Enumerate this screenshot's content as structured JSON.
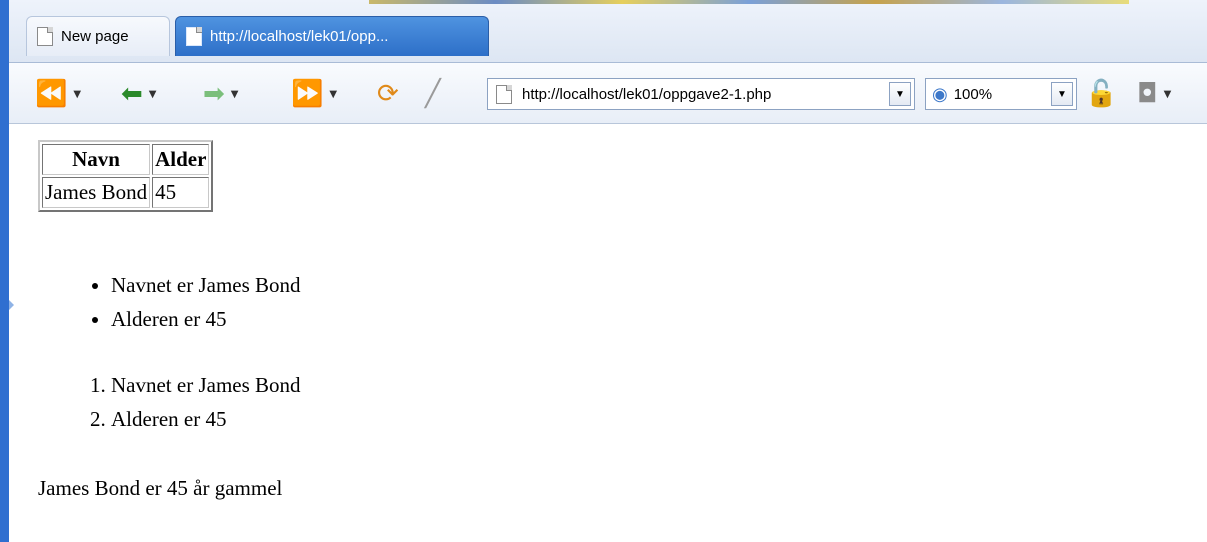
{
  "tabs": [
    {
      "label": "New page",
      "active": false
    },
    {
      "label": "http://localhost/lek01/opp...",
      "active": true
    }
  ],
  "toolbar": {
    "address": "http://localhost/lek01/oppgave2-1.php",
    "zoom": "100%",
    "icons": [
      "back-all-icon",
      "back-icon",
      "forward-icon",
      "forward-all-icon",
      "reload-icon",
      "edit-icon",
      "page-icon",
      "eye-icon",
      "lock-icon",
      "camera-icon"
    ]
  },
  "content": {
    "table": {
      "headers": [
        "Navn",
        "Alder"
      ],
      "rows": [
        [
          "James Bond",
          "45"
        ]
      ]
    },
    "bullets": [
      "Navnet er James Bond",
      "Alderen er 45"
    ],
    "numbered": [
      "Navnet er James Bond",
      "Alderen er 45"
    ],
    "sentence": "James Bond er 45 år gammel"
  },
  "colors": {
    "frame": "#2f6fd0",
    "active_tab": "#2d6fc8",
    "back_arrow": "#2b8a2b",
    "forward_arrow": "#7bbf7b",
    "nav_blue": "#3d78c9"
  }
}
